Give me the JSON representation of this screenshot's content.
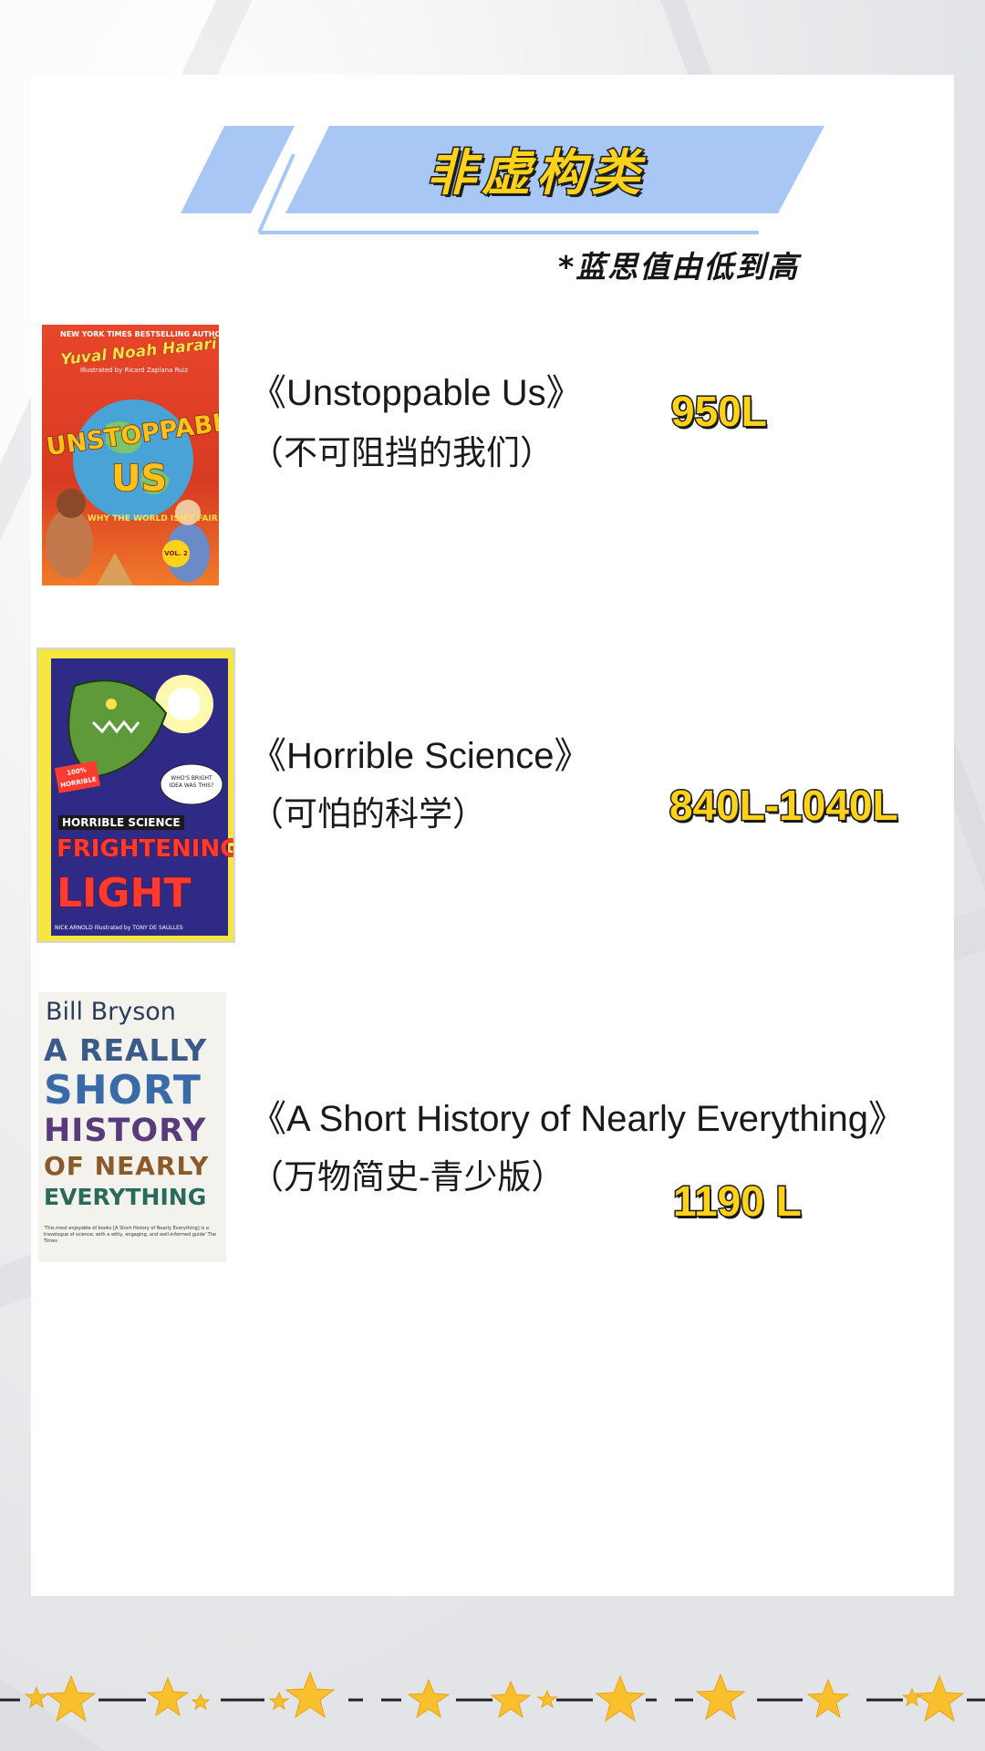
{
  "header": {
    "title": "非虚构类",
    "note": "*蓝思值由低到高"
  },
  "books": [
    {
      "title": "《Unstoppable Us》",
      "subtitle": "（不可阻挡的我们）",
      "lexile": "950L",
      "cover": {
        "tagline": "NEW YORK TIMES BESTSELLING AUTHOR",
        "author": "Yuval Noah Harari",
        "illustrator": "Illustrated by Ricard Zaplana Ruiz",
        "title_line1": "UNSTOPPABLE",
        "title_line2": "US",
        "series": "WHY THE WORLD ISN'T FAIR",
        "vol": "VOL. 2",
        "colors": {
          "bg": "#e8462a",
          "globe": "#4aa3d6",
          "title": "#ffc21a"
        }
      }
    },
    {
      "title": "《Horrible Science》",
      "subtitle": "（可怕的科学）",
      "lexile": "840L-1040L",
      "cover": {
        "badge": "100% HORRIBLE",
        "speech": "WHO'S BRIGHT IDEA WAS THIS?",
        "series": "HORRIBLE SCIENCE",
        "title_line1": "FRIGHTENING",
        "title_line2": "LIGHT",
        "credits": "NICK ARNOLD  Illustrated by TONY DE SAULLES",
        "colors": {
          "bg": "#2f2a86",
          "frame": "#f5e640",
          "title": "#ff3b2f"
        }
      }
    },
    {
      "title": "《A Short History of Nearly Everything》",
      "subtitle": "（万物简史-青少版）",
      "lexile": "1190 L",
      "cover": {
        "author": "Bill Bryson",
        "lines": [
          "A REALLY",
          "SHORT",
          "HISTORY",
          "OF NEARLY",
          "EVERYTHING"
        ],
        "quote": "'This most enjoyable of books [A Short History of Nearly Everything] is a travelogue of science, with a witty, engaging, and well-informed guide' The Times",
        "colors": {
          "bg": "#f4f2ec",
          "text": "#2c3a5c"
        }
      }
    }
  ],
  "colors": {
    "banner_blue": "#a9c7f5",
    "lexile_yellow": "#ffd21a",
    "star_yellow": "#f9bf2c"
  }
}
